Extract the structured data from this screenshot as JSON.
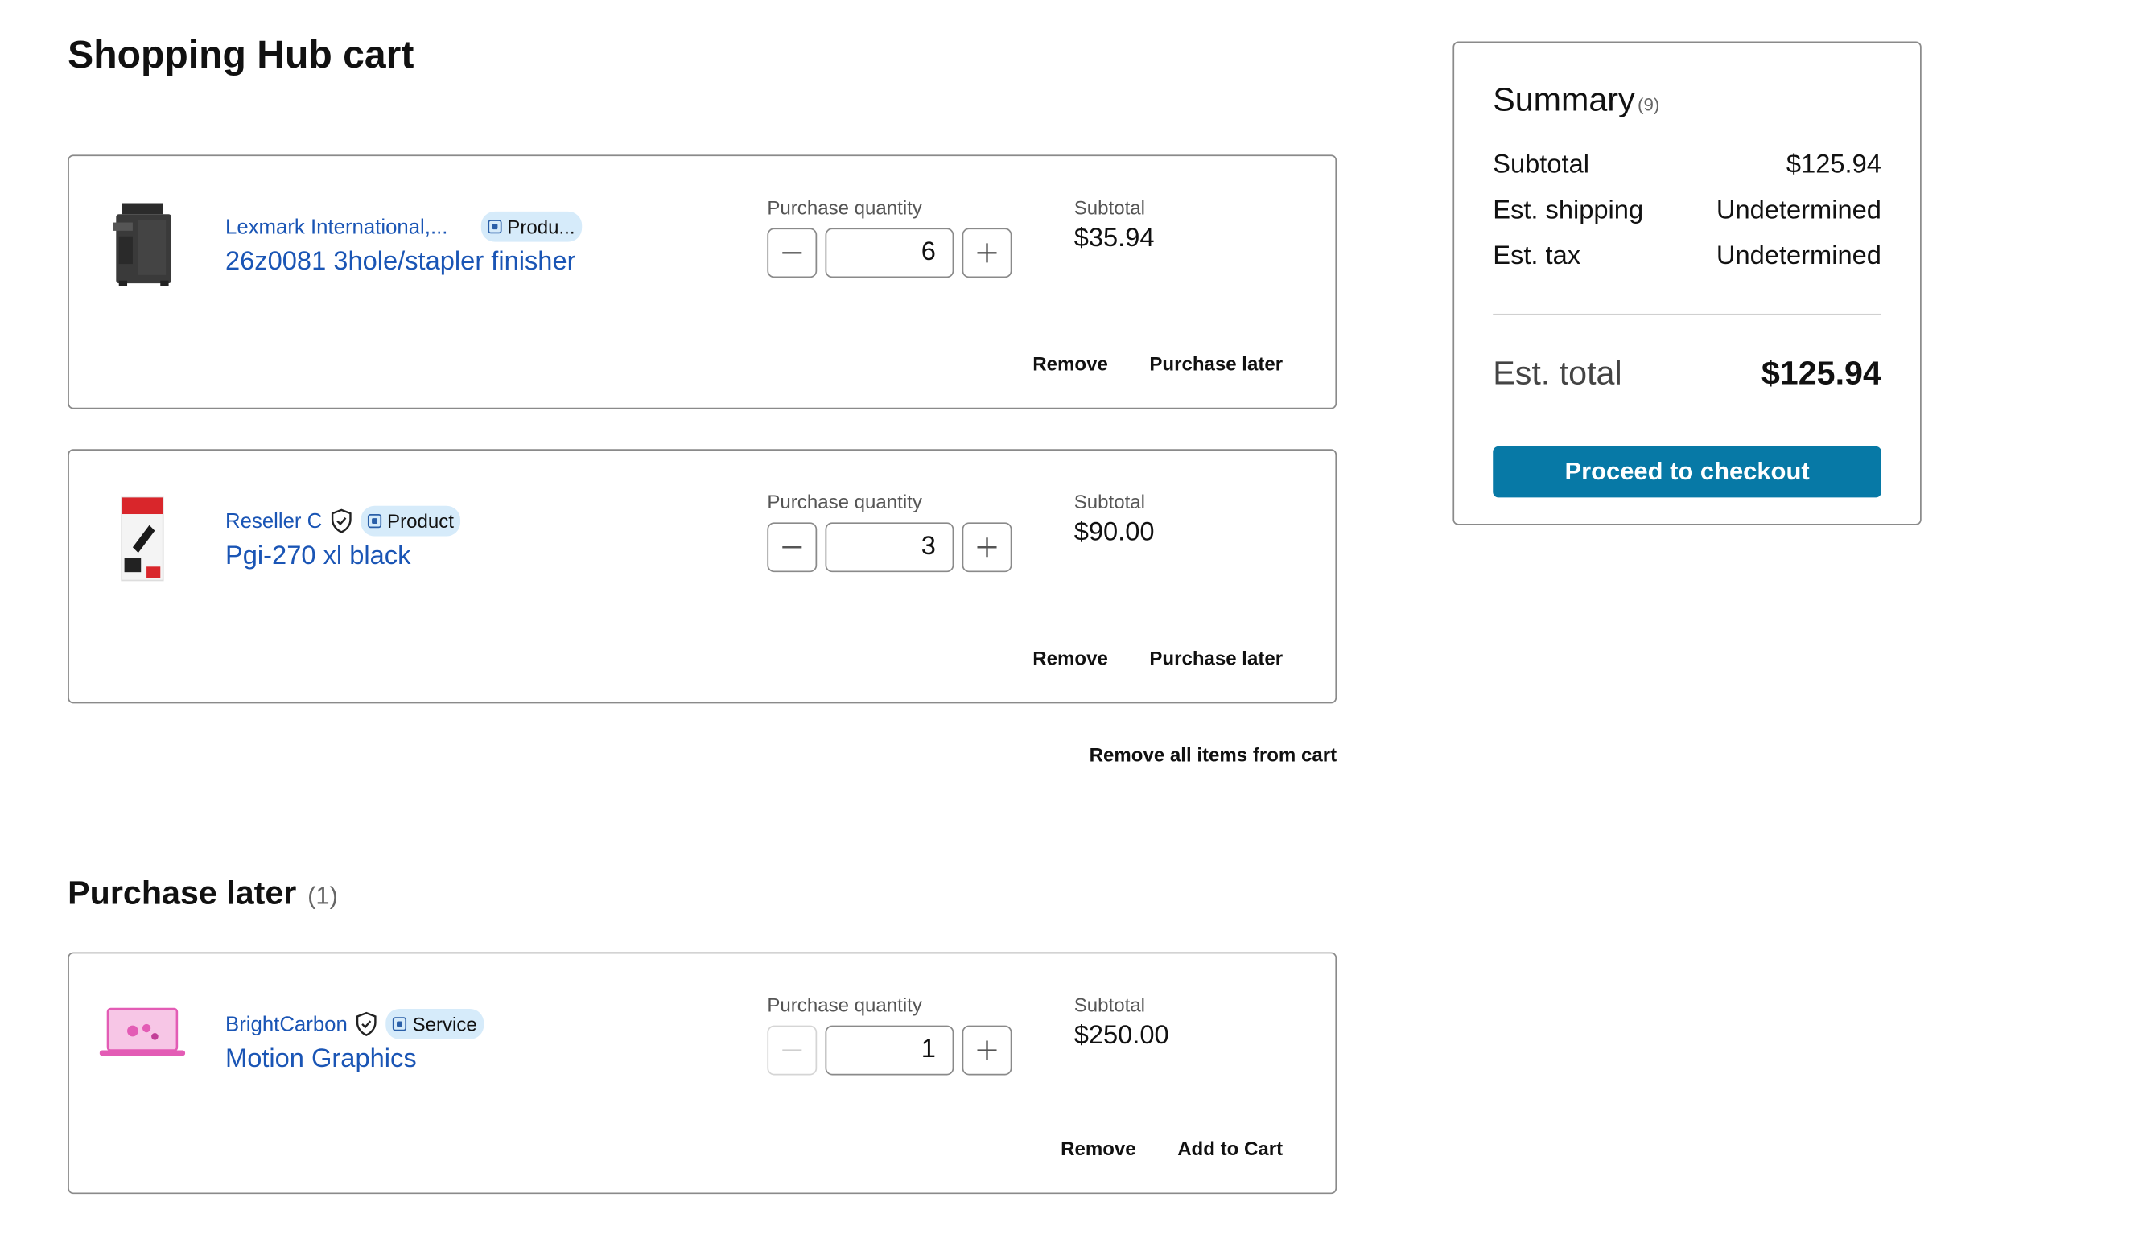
{
  "page": {
    "title": "Shopping Hub cart"
  },
  "cart_items": [
    {
      "seller": "Lexmark International,...",
      "badge": "Produ...",
      "title": "26z0081 3hole/stapler finisher",
      "qty_label": "Purchase quantity",
      "quantity": "6",
      "subtotal_label": "Subtotal",
      "subtotal": "$35.94",
      "remove_label": "Remove",
      "secondary_label": "Purchase later",
      "image_icon": "printer-finisher-icon"
    },
    {
      "seller": "Reseller C",
      "badge": "Product",
      "title": "Pgi-270 xl black",
      "qty_label": "Purchase quantity",
      "quantity": "3",
      "subtotal_label": "Subtotal",
      "subtotal": "$90.00",
      "remove_label": "Remove",
      "secondary_label": "Purchase later",
      "image_icon": "ink-cartridge-icon"
    }
  ],
  "remove_all_label": "Remove all items from cart",
  "purchase_later": {
    "heading": "Purchase later",
    "count": "(1)",
    "items": [
      {
        "seller": "BrightCarbon",
        "badge": "Service",
        "title": "Motion Graphics",
        "qty_label": "Purchase quantity",
        "quantity": "1",
        "subtotal_label": "Subtotal",
        "subtotal": "$250.00",
        "remove_label": "Remove",
        "secondary_label": "Add to Cart",
        "image_icon": "laptop-graphics-icon"
      }
    ]
  },
  "summary": {
    "title": "Summary",
    "count": "(9)",
    "subtotal_label": "Subtotal",
    "subtotal": "$125.94",
    "shipping_label": "Est. shipping",
    "shipping": "Undetermined",
    "tax_label": "Est. tax",
    "tax": "Undetermined",
    "total_label": "Est. total",
    "total": "$125.94",
    "checkout_label": "Proceed to checkout"
  },
  "colors": {
    "link": "#1a55b5",
    "badge_bg": "#d6ebfa",
    "checkout_bg": "#0779a6"
  }
}
